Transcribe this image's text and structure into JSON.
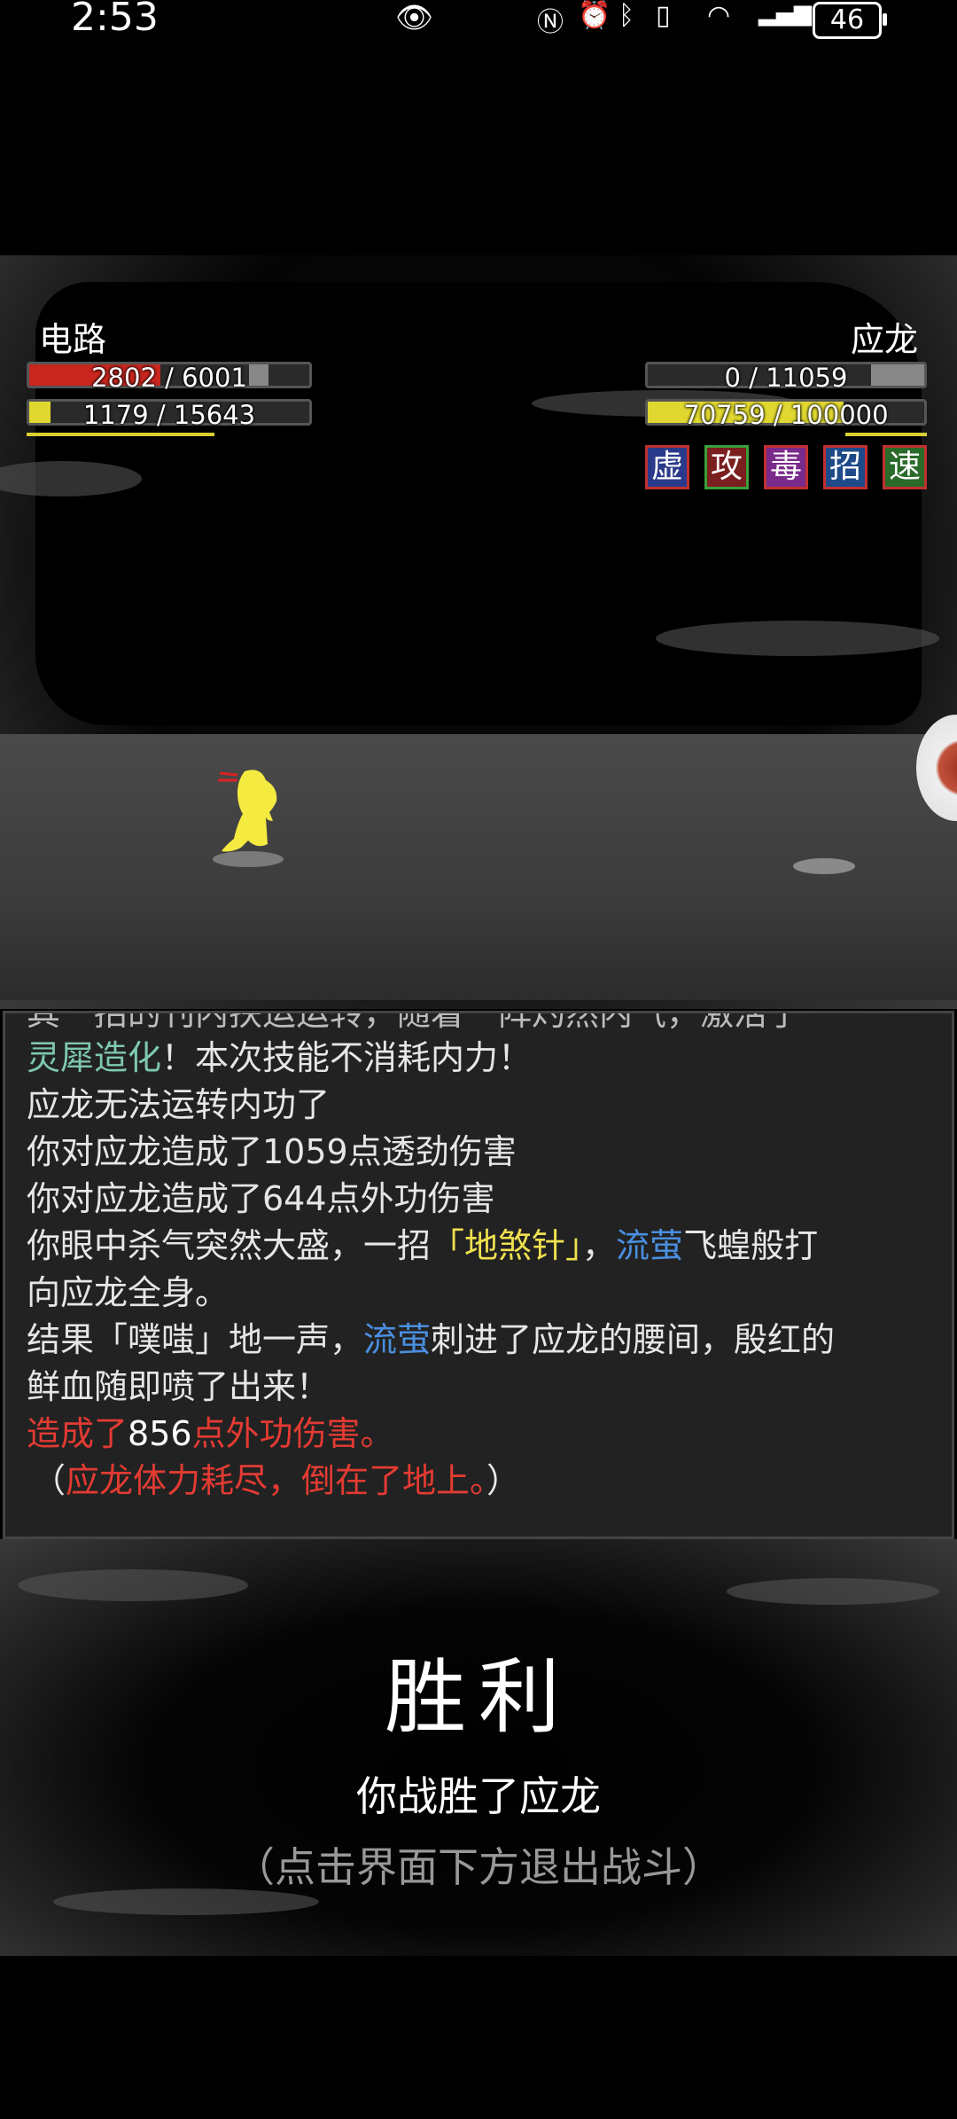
{
  "status_bar": {
    "time": "2:53",
    "battery": "46",
    "icons": [
      "eye-icon",
      "nfc-icon",
      "alarm-icon",
      "bluetooth-icon",
      "vibrate-icon",
      "wifi-icon",
      "4g-signal-icon",
      "battery-icon"
    ]
  },
  "player": {
    "name": "电路",
    "hp_text": "2802 / 6001",
    "hp_fraction": 0.467,
    "mp_text": "1179 / 15643",
    "mp_fraction": 0.075,
    "hp_color": "#c8261e",
    "mp_color": "#e0d830"
  },
  "enemy": {
    "name": "应龙",
    "hp_text": "0 / 11059",
    "hp_fraction": 0,
    "mp_text": "70759 / 100000",
    "mp_fraction": 0.708,
    "buffs": [
      {
        "label": "虚",
        "bg": "#2a3a8a"
      },
      {
        "label": "攻",
        "bg": "#7a1e1e"
      },
      {
        "label": "毒",
        "bg": "#7a2a8a"
      },
      {
        "label": "招",
        "bg": "#1e4a8a"
      },
      {
        "label": "速",
        "bg": "#2a6a2a"
      }
    ]
  },
  "log": {
    "partial_line": "其一招的刊内扶运运转，随着一阵灼然内气，激活了",
    "line1": {
      "teal": "灵犀造化",
      "rest": "！本次技能不消耗内力！"
    },
    "line2": "应龙无法运转内功了",
    "line3": "你对应龙造成了1059点透劲伤害",
    "line4": "你对应龙造成了644点外功伤害",
    "line5": {
      "a": "你眼中杀气突然大盛，一招",
      "skill": "「地煞针」",
      "b": "，",
      "weapon": "流萤",
      "c": "飞蝗般打"
    },
    "line6": "向应龙全身。",
    "line7": {
      "a": "结果「噗嗤」地一声，",
      "weapon": "流萤",
      "b": "刺进了应龙的腰间，殷红的"
    },
    "line8": "鲜血随即喷了出来！",
    "line9": {
      "a": "造成了",
      "num": "856",
      "b": "点外功伤害。"
    },
    "line10": {
      "open": "（",
      "text": "应龙体力耗尽，倒在了地上。",
      "close": "）"
    }
  },
  "victory": {
    "title": "胜利",
    "subtitle": "你战胜了应龙",
    "hint": "（点击界面下方退出战斗）"
  }
}
